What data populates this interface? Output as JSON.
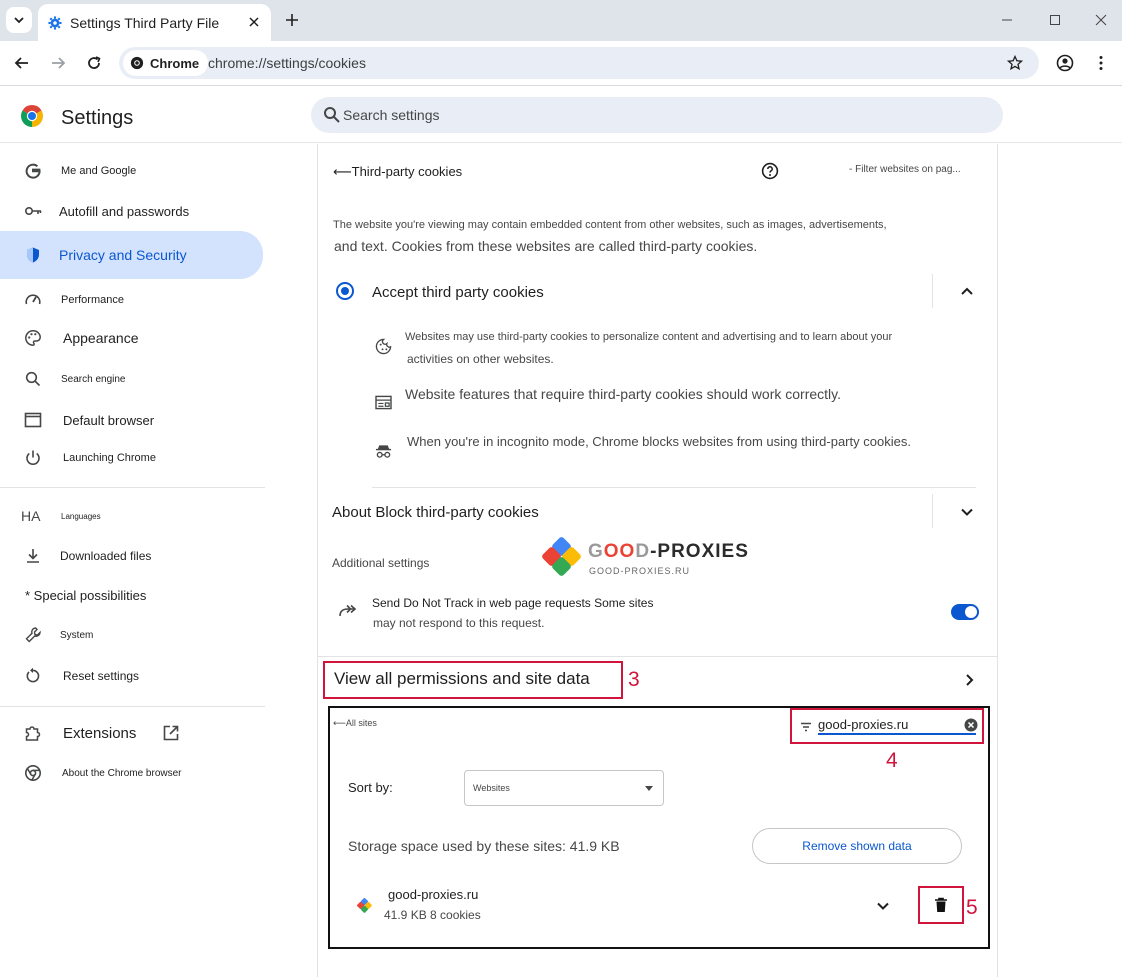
{
  "tab": {
    "title": "Settings Third Party File"
  },
  "toolbar": {
    "chip_label": "Chrome",
    "url": "chrome://settings/cookies"
  },
  "header": {
    "title": "Settings",
    "search_placeholder": "Search settings"
  },
  "sidebar": {
    "items": [
      {
        "label": "Me and Google"
      },
      {
        "label": "Autofill and passwords"
      },
      {
        "label": "Privacy and Security"
      },
      {
        "label": "Performance"
      },
      {
        "label": "Appearance"
      },
      {
        "label": "Search engine"
      },
      {
        "label": "Default browser"
      },
      {
        "label": "Launching Chrome"
      },
      {
        "label": "Languages",
        "icon_text": "HA"
      },
      {
        "label": "Downloaded files"
      },
      {
        "label": "* Special possibilities"
      },
      {
        "label": "System"
      },
      {
        "label": "Reset settings"
      },
      {
        "label": "Extensions"
      },
      {
        "label": "About the Chrome browser"
      }
    ]
  },
  "panel": {
    "back_title": "⟵Third-party cookies",
    "filter_text": "- Filter websites on pag...",
    "description_line1": "The website you're viewing may contain embedded content from other websites, such as images, advertisements,",
    "description_line2": "and text. Cookies from these websites are called third-party cookies.",
    "accept_label": "Accept third party cookies",
    "bullet1_line1": "Websites may use third-party cookies to personalize content and advertising and to learn about your",
    "bullet1_line2": "activities on other websites.",
    "bullet2": "Website features that require third-party cookies should work correctly.",
    "bullet3": "When you're in incognito mode, Chrome blocks websites from using third-party cookies.",
    "about_block_label": "About Block third-party cookies",
    "additional_settings": "Additional settings",
    "watermark": {
      "brand_prefix": "G",
      "brand_oo": "OO",
      "brand_d": "D",
      "brand_suffix": "-PROXIES",
      "site": "GOOD-PROXIES.RU"
    },
    "dnt_line1": "Send Do Not Track in web page requests Some sites",
    "dnt_line2": "may not respond to this request.",
    "dnt_enabled": true,
    "view_all_label": "View all permissions and site data",
    "callout_3": "3"
  },
  "sites": {
    "back_label": "⟵All sites",
    "filter_value": "good-proxies.ru",
    "callout_4": "4",
    "sort_label": "Sort by:",
    "sort_value": "Websites",
    "storage_text": "Storage space used by these sites: 41.9 KB",
    "remove_button": "Remove shown data",
    "site_name": "good-proxies.ru",
    "site_meta": "41.9 KB 8 cookies",
    "callout_5": "5"
  },
  "colors": {
    "accent": "#0b57d0",
    "callout_red": "#d0143c",
    "active_nav": "#d3e3fd"
  }
}
